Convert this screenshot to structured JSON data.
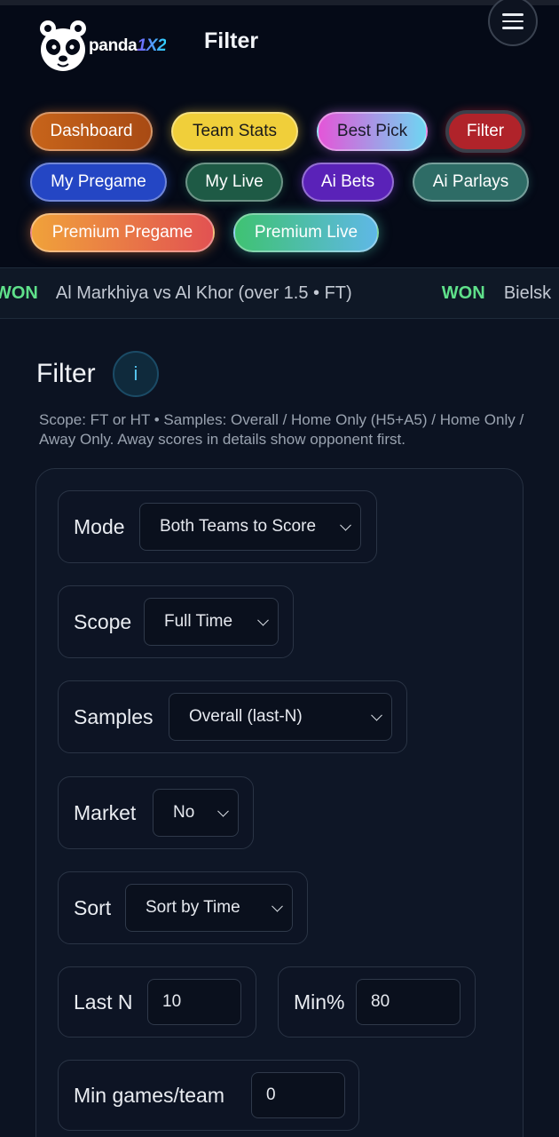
{
  "brand": {
    "name_main": "panda",
    "name_accent": "1X2"
  },
  "header": {
    "title": "Filter"
  },
  "nav": {
    "dashboard": "Dashboard",
    "team_stats": "Team Stats",
    "best_pick": "Best Pick",
    "filter": "Filter",
    "my_pregame": "My Pregame",
    "my_live": "My Live",
    "ai_bets": "Ai Bets",
    "ai_parlays": "Ai Parlays",
    "premium_pregame": "Premium Pregame",
    "premium_live": "Premium Live"
  },
  "ticker": {
    "items": [
      {
        "status": "WON",
        "text": "Al Markhiya vs Al Khor (over 1.5 • FT)"
      },
      {
        "status": "WON",
        "text": "Bielsk"
      }
    ]
  },
  "filter_section": {
    "title": "Filter",
    "info_label": "i",
    "description": "Scope: FT or HT • Samples: Overall / Home Only (H5+A5) / Home Only / Away Only. Away scores in details show opponent first."
  },
  "form": {
    "mode": {
      "label": "Mode",
      "value": "Both Teams to Score"
    },
    "scope": {
      "label": "Scope",
      "value": "Full Time"
    },
    "samples": {
      "label": "Samples",
      "value": "Overall (last-N)"
    },
    "market": {
      "label": "Market",
      "value": "No"
    },
    "sort": {
      "label": "Sort",
      "value": "Sort by Time"
    },
    "last_n": {
      "label": "Last N",
      "value": "10"
    },
    "min_pct": {
      "label": "Min%",
      "value": "80"
    },
    "min_games": {
      "label": "Min games/team",
      "value": "0"
    }
  },
  "colors": {
    "background": "#0b1120",
    "won": "#5fe08a",
    "filter_active": "#b0232a",
    "info_accent": "#56c7f2"
  }
}
